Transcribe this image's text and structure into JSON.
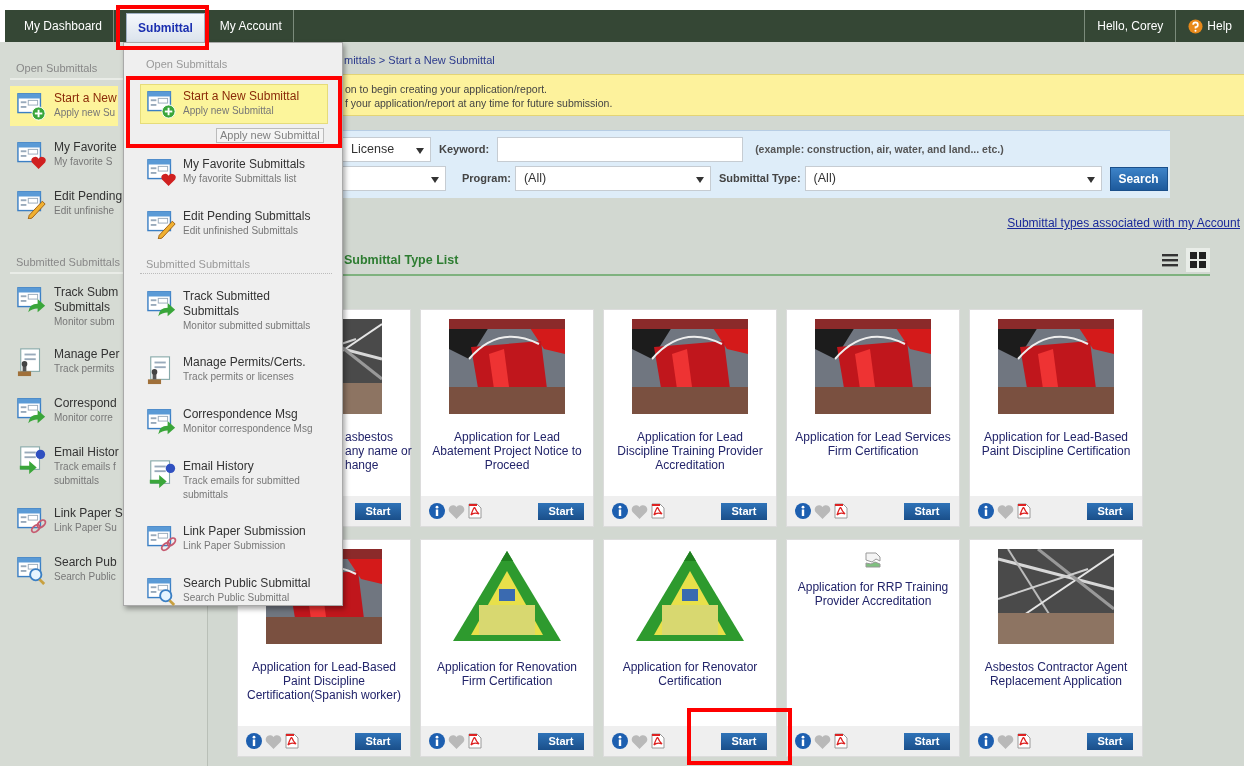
{
  "nav": {
    "tabs": [
      {
        "label": "My Dashboard",
        "selected": false,
        "highlight": false
      },
      {
        "label": "Submittal",
        "selected": true,
        "highlight": true
      },
      {
        "label": "My Account",
        "selected": false,
        "highlight": false
      }
    ],
    "greeting": "Hello, Corey",
    "help": "Help"
  },
  "sidebar": {
    "sections": [
      {
        "title": "Open Submittals",
        "items": [
          {
            "kind": "new",
            "title": [
              "Start a New"
            ],
            "subtitle": [
              "Apply new Su"
            ],
            "selected": true
          },
          {
            "kind": "favorite",
            "title": [
              "My Favorite"
            ],
            "subtitle": [
              "My favorite S"
            ],
            "selected": false
          },
          {
            "kind": "edit",
            "title": [
              "Edit Pending"
            ],
            "subtitle": [
              "Edit unfinishe"
            ],
            "selected": false
          }
        ]
      },
      {
        "title": "Submitted Submittals",
        "items": [
          {
            "kind": "track",
            "title": [
              "Track Subm",
              "Submittals"
            ],
            "subtitle": [
              "Monitor subm"
            ],
            "selected": false
          },
          {
            "kind": "permits",
            "title": [
              "Manage Per"
            ],
            "subtitle": [
              "Track permits"
            ],
            "selected": false
          },
          {
            "kind": "correspondence",
            "title": [
              "Correspond"
            ],
            "subtitle": [
              "Monitor corre"
            ],
            "selected": false
          },
          {
            "kind": "email",
            "title": [
              "Email Histor"
            ],
            "subtitle": [
              "Track emails f",
              "submittals"
            ],
            "selected": false
          },
          {
            "kind": "link",
            "title": [
              "Link Paper S"
            ],
            "subtitle": [
              "Link Paper Su"
            ],
            "selected": false
          },
          {
            "kind": "search",
            "title": [
              "Search Pub"
            ],
            "subtitle": [
              "Search Public"
            ],
            "selected": false
          }
        ]
      }
    ]
  },
  "menu": {
    "sections": [
      {
        "title": "Open Submittals",
        "items": [
          {
            "kind": "new",
            "title": "Start a New Submittal",
            "subtitle": "Apply new Submittal",
            "selected": true,
            "highlight": true,
            "tooltip": "Apply new Submittal"
          },
          {
            "kind": "favorite",
            "title": "My Favorite Submittals",
            "subtitle": "My favorite Submittals list",
            "selected": false,
            "highlight": false
          },
          {
            "kind": "edit",
            "title": "Edit Pending Submittals",
            "subtitle": "Edit unfinished Submittals",
            "selected": false,
            "highlight": false
          }
        ]
      },
      {
        "title": "Submitted Submittals",
        "items": [
          {
            "kind": "track",
            "title": "Track Submitted Submittals",
            "subtitle": "Monitor submitted submittals",
            "selected": false,
            "highlight": false
          },
          {
            "kind": "permits",
            "title": "Manage Permits/Certs.",
            "subtitle": "Track permits or licenses",
            "selected": false,
            "highlight": false
          },
          {
            "kind": "correspondence",
            "title": "Correspondence Msg",
            "subtitle": "Monitor correspondence Msg",
            "selected": false,
            "highlight": false
          },
          {
            "kind": "email",
            "title": "Email History",
            "subtitle": "Track emails for submitted submittals",
            "selected": false,
            "highlight": false
          },
          {
            "kind": "link",
            "title": "Link Paper Submission",
            "subtitle": "Link Paper Submission",
            "selected": false,
            "highlight": false
          },
          {
            "kind": "search",
            "title": "Search Public Submittal",
            "subtitle": "Search Public Submittal",
            "selected": false,
            "highlight": false
          }
        ]
      }
    ]
  },
  "breadcrumb": "mittals > Start a New Submittal",
  "notice": [
    "on to begin creating your application/report.",
    "f your application/report at any time for future submission."
  ],
  "search": {
    "category": "License",
    "keyword_label": "Keyword:",
    "keyword_hint": "(example: construction, air, water, and land... etc.)",
    "program_label": "Program:",
    "program": "(All)",
    "type_label": "Submittal Type:",
    "type": "(All)",
    "button": "Search"
  },
  "account_link": "Submittal types associated with my Account",
  "list": {
    "title": "Submittal Type List",
    "views": [
      {
        "kind": "list",
        "selected": false
      },
      {
        "kind": "grid",
        "selected": true
      }
    ]
  },
  "cards": [
    {
      "kind": "partial",
      "lines": [
        "asbestos",
        "any name or",
        "hange"
      ],
      "button": "Start",
      "highlight": false
    },
    {
      "kind": "full",
      "description": "Application for Lead Abatement Project Notice to Proceed",
      "button": "Start",
      "highlight": false
    },
    {
      "kind": "full",
      "description": "Application for Lead Discipline Training Provider Accreditation",
      "button": "Start",
      "highlight": false
    },
    {
      "kind": "full",
      "description": "Application for Lead Services Firm Certification",
      "button": "Start",
      "highlight": false
    },
    {
      "kind": "full",
      "description": "Application for Lead-Based Paint Discipline Certification",
      "button": "Start",
      "highlight": false
    },
    {
      "kind": "full",
      "description": "Application for Lead-Based Paint Discipline Certification(Spanish worker)",
      "button": "Start",
      "highlight": false
    },
    {
      "kind": "full",
      "description": "Application for Renovation Firm Certification",
      "button": "Start",
      "highlight": false
    },
    {
      "kind": "full",
      "description": "Application for Renovator Certification",
      "button": "Start",
      "highlight": true
    },
    {
      "kind": "full",
      "image": {
        "kind": "broken"
      },
      "description": "Application for RRP Training Provider Accreditation",
      "button": "Start",
      "highlight": false
    },
    {
      "kind": "full",
      "description": "Asbestos Contractor Agent Replacement Application",
      "button": "Start",
      "highlight": false
    }
  ]
}
